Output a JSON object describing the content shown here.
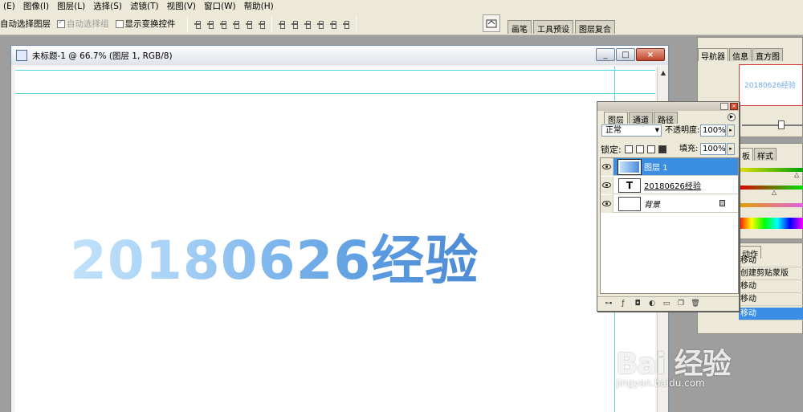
{
  "menubar": {
    "items": [
      "(E)",
      "图像(I)",
      "图层(L)",
      "选择(S)",
      "滤镜(T)",
      "视图(V)",
      "窗口(W)",
      "帮助(H)"
    ]
  },
  "options": {
    "auto_select_layer": "自动选择图层",
    "auto_select_group": "自动选择组",
    "show_transform_controls": "显示变换控件"
  },
  "palette_well": {
    "tabs": [
      "画笔",
      "工具预设",
      "图层复合"
    ]
  },
  "document": {
    "title": "未标题-1 @ 66.7% (图层 1, RGB/8)",
    "canvas_text": "20180626经验",
    "minimize": "_",
    "restore": "□",
    "close": "×"
  },
  "navigator": {
    "tabs": [
      "导航器",
      "信息",
      "直方图"
    ],
    "thumb_text": "20180626经验"
  },
  "color_panel": {
    "tabs": [
      "板",
      "样式"
    ]
  },
  "actions_panel": {
    "tab": "动作",
    "rows": [
      "移动",
      "创建剪贴蒙版",
      "移动",
      "移动",
      "移动"
    ]
  },
  "layers": {
    "tabs": [
      "图层",
      "通道",
      "路径"
    ],
    "blend_mode": "正常",
    "opacity_label": "不透明度:",
    "opacity_value": "100%",
    "lock_label": "锁定:",
    "fill_label": "填充:",
    "fill_value": "100%",
    "rows": [
      {
        "name": "图层 1",
        "thumb": ""
      },
      {
        "name": "20180626经验",
        "thumb": "T"
      },
      {
        "name": "背景",
        "thumb": ""
      }
    ]
  },
  "watermark": {
    "brand": "Bai 经验",
    "url": "jingyan.baidu.com"
  },
  "colors": {
    "selection": "#3c8ee3",
    "text_gradient_start": "#c2e2fb",
    "text_gradient_end": "#4d8bd6"
  }
}
